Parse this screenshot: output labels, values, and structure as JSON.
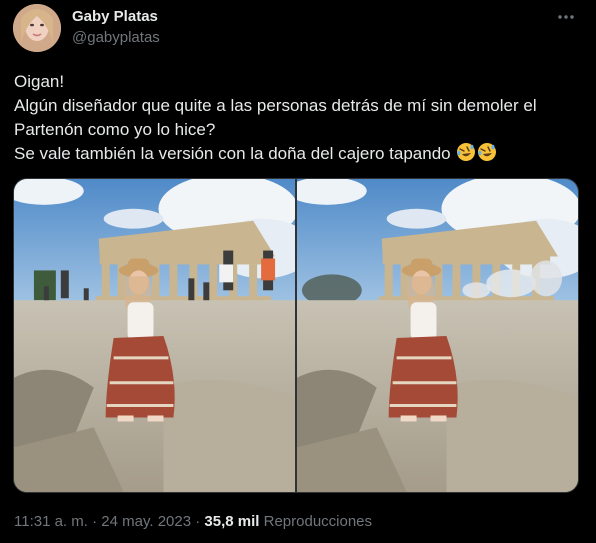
{
  "author": {
    "name": "Gaby Platas",
    "handle": "@gabyplatas"
  },
  "tweet": {
    "lines": [
      "Oigan!",
      "Algún diseñador que quite a las personas detrás de mí sin demoler el",
      "Partenón como yo lo hice?",
      "Se vale también la versión con la doña del cajero tapando"
    ],
    "emoji": [
      "rolling-on-floor-laughing",
      "rolling-on-floor-laughing"
    ]
  },
  "meta": {
    "time": "11:31 a. m.",
    "separator1": "·",
    "date": "24 may. 2023",
    "separator2": "·",
    "views": "35,8 mil",
    "views_label": "Reproducciones"
  },
  "icons": {
    "more": "more-horizontal-icon"
  },
  "colors": {
    "background": "#000000",
    "text": "#e7e9ea",
    "secondary": "#71767b",
    "border": "#2f3336"
  }
}
